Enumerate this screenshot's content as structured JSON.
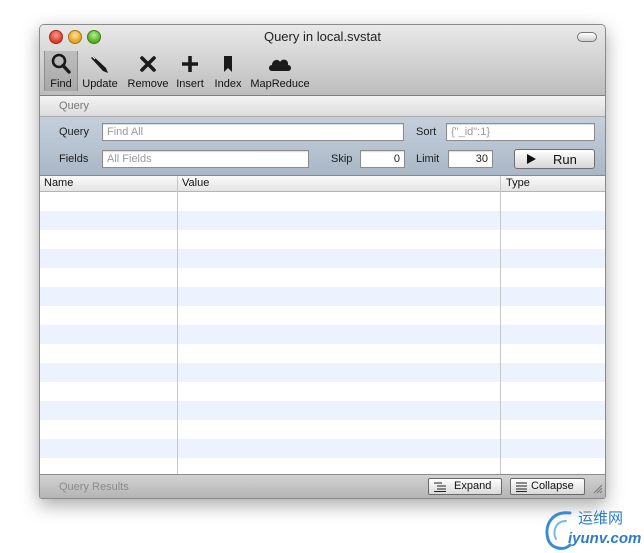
{
  "window": {
    "title": "Query in local.svstat"
  },
  "toolbar": {
    "items": [
      {
        "label": "Find",
        "icon": "magnifier-icon"
      },
      {
        "label": "Update",
        "icon": "pen-icon"
      },
      {
        "label": "Remove",
        "icon": "x-icon"
      },
      {
        "label": "Insert",
        "icon": "plus-icon"
      },
      {
        "label": "Index",
        "icon": "bookmark-icon"
      },
      {
        "label": "MapReduce",
        "icon": "cloud-icon"
      }
    ]
  },
  "section": {
    "label": "Query"
  },
  "form": {
    "query_label": "Query",
    "query_placeholder": "Find All",
    "sort_label": "Sort",
    "sort_placeholder": "{\"_id\":1}",
    "fields_label": "Fields",
    "fields_placeholder": "All Fields",
    "skip_label": "Skip",
    "skip_value": "0",
    "limit_label": "Limit",
    "limit_value": "30",
    "run_label": "Run"
  },
  "table": {
    "columns": [
      "Name",
      "Value",
      "Type"
    ]
  },
  "statusbar": {
    "text": "Query Results",
    "expand_label": "Expand",
    "collapse_label": "Collapse"
  },
  "watermark": {
    "cn": "运维网",
    "en": "iyunv.com"
  }
}
